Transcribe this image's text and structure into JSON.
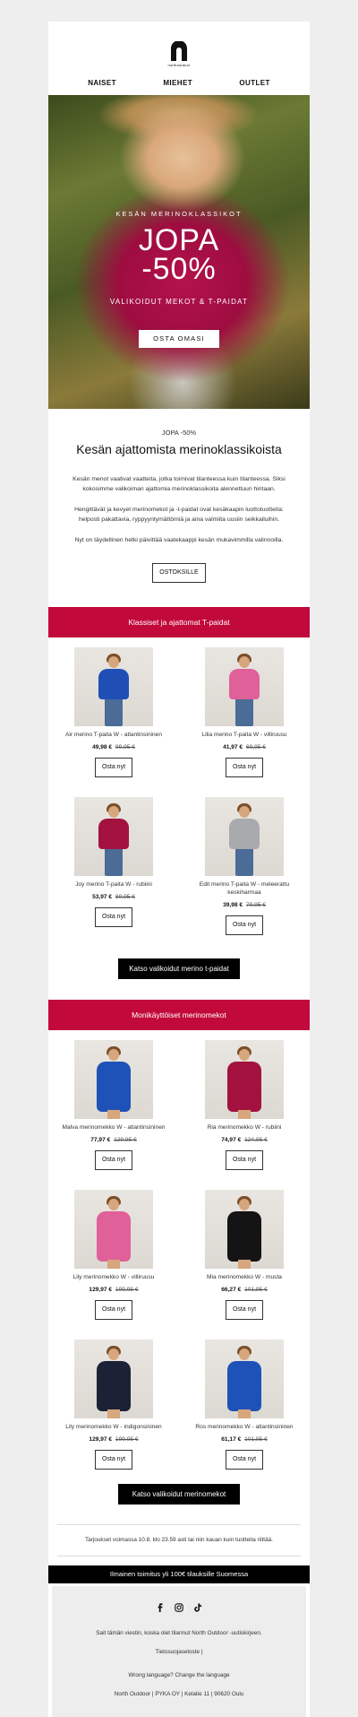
{
  "brand": {
    "logo_text": "northoutdoor"
  },
  "nav": [
    "NAISET",
    "MIEHET",
    "OUTLET"
  ],
  "hero": {
    "kicker": "KESÄN MERINOKLASSIKOT",
    "line1": "JOPA",
    "line2": "-50%",
    "sub": "VALIKOIDUT MEKOT & T-PAIDAT",
    "cta": "OSTA OMASI"
  },
  "intro": {
    "kicker": "JOPA -50%",
    "title": "Kesän ajattomista merinoklassikoista",
    "p1": "Kesän menot vaativat vaatteita, jotka toimivat tilanteessa kuin tilanteessa. Siksi kokosimme valikoiman ajattomia merinoklassikoita alennettuun hintaan.",
    "p2": "Hengittävät ja kevyet merinomekot ja -t-paidat ovat kesäkaapin luottotuotteita: helposti pakattavia, ryppyyntymättömiä ja aina valmiita uusiin seikkailuihin.",
    "p3": "Nyt on täydellinen hetki päivittää vaatekaappi kesän mukavimmilla valinnoilla.",
    "cta": "OSTOKSILLE"
  },
  "section1": {
    "title": "Klassiset ja ajattomat T-paidat",
    "cta": "Katso valikoidut merino t-paidat",
    "products": [
      {
        "name": "Air merino T-paita W - atlantinsininen",
        "price": "49,98 €",
        "old": "99,95 €",
        "button": "Osta nyt",
        "color": "#1f4fb4"
      },
      {
        "name": "Lilia merino T-paita W - villiruusu",
        "price": "41,97 €",
        "old": "69,95 €",
        "button": "Osta nyt",
        "color": "#e0609a"
      },
      {
        "name": "Joy merino T-paita W - rubiini",
        "price": "53,97 €",
        "old": "89,95 €",
        "button": "Osta nyt",
        "color": "#a3123f"
      },
      {
        "name": "Edit merino T-paita W - meleerattu keskiharmaa",
        "price": "39,98 €",
        "old": "79,95 €",
        "button": "Osta nyt",
        "color": "#a9aaad"
      }
    ]
  },
  "section2": {
    "title": "Monikäyttöiset merinomekot",
    "cta": "Katso valikoidut merinomekot",
    "products": [
      {
        "name": "Malva merinomekko W - atlantinsininen",
        "price": "77,97 €",
        "old": "129,95 €",
        "button": "Osta nyt",
        "color": "#1f52b8"
      },
      {
        "name": "Ria merinomekko W - rubiini",
        "price": "74,97 €",
        "old": "124,95 €",
        "button": "Osta nyt",
        "color": "#a3123f"
      },
      {
        "name": "Lily merinomekko W - villiruusu",
        "price": "129,97 €",
        "old": "199,95 €",
        "button": "Osta nyt",
        "color": "#e0609a"
      },
      {
        "name": "Mia merinomekko W - musta",
        "price": "66,27 €",
        "old": "101,95 €",
        "button": "Osta nyt",
        "color": "#141414"
      },
      {
        "name": "Lily merinomekko W - indigonsininen",
        "price": "129,97 €",
        "old": "199,95 €",
        "button": "Osta nyt",
        "color": "#1c2236"
      },
      {
        "name": "Ros merinomekko W - atlantinsininen",
        "price": "61,17 €",
        "old": "101,95 €",
        "button": "Osta nyt",
        "color": "#1f52b8"
      }
    ]
  },
  "terms": "Tarjoukset voimassa 10.8. klo 23.59 asti tai niin kauan kuin tuotteita riittää.",
  "shipping": "Ilmainen toimitus yli 100€ tilauksille Suomessa",
  "social": [
    "facebook-icon",
    "instagram-icon",
    "tiktok-icon"
  ],
  "footer": {
    "line1": "Sait tämän viestin, koska olet tilannut North Outdoor -uutiskirjeen.",
    "line2": "Tietosuojaseloste |",
    "line3": "Wrong language? Change the language",
    "line4": "North Outdoor | PYKA OY | Kelatie 11 | 90620 Oulu"
  }
}
